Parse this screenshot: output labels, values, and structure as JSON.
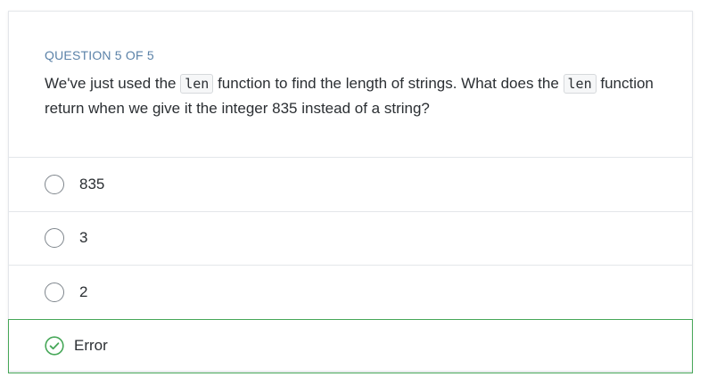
{
  "question": {
    "counter": "QUESTION 5 OF 5",
    "text_part1": "We've just used the ",
    "code1": "len",
    "text_part2": " function to find the length of strings. What does the ",
    "code2": "len",
    "text_part3": " function return when we give it the integer 835 instead of a string?"
  },
  "options": [
    {
      "label": "835",
      "state": "unselected"
    },
    {
      "label": "3",
      "state": "unselected"
    },
    {
      "label": "2",
      "state": "unselected"
    },
    {
      "label": "Error",
      "state": "correct"
    }
  ],
  "colors": {
    "correct": "#46a758",
    "counter": "#5b82a8"
  },
  "icons": {
    "correct_icon": "check-circle-icon",
    "radio_icon": "radio-circle-icon"
  }
}
